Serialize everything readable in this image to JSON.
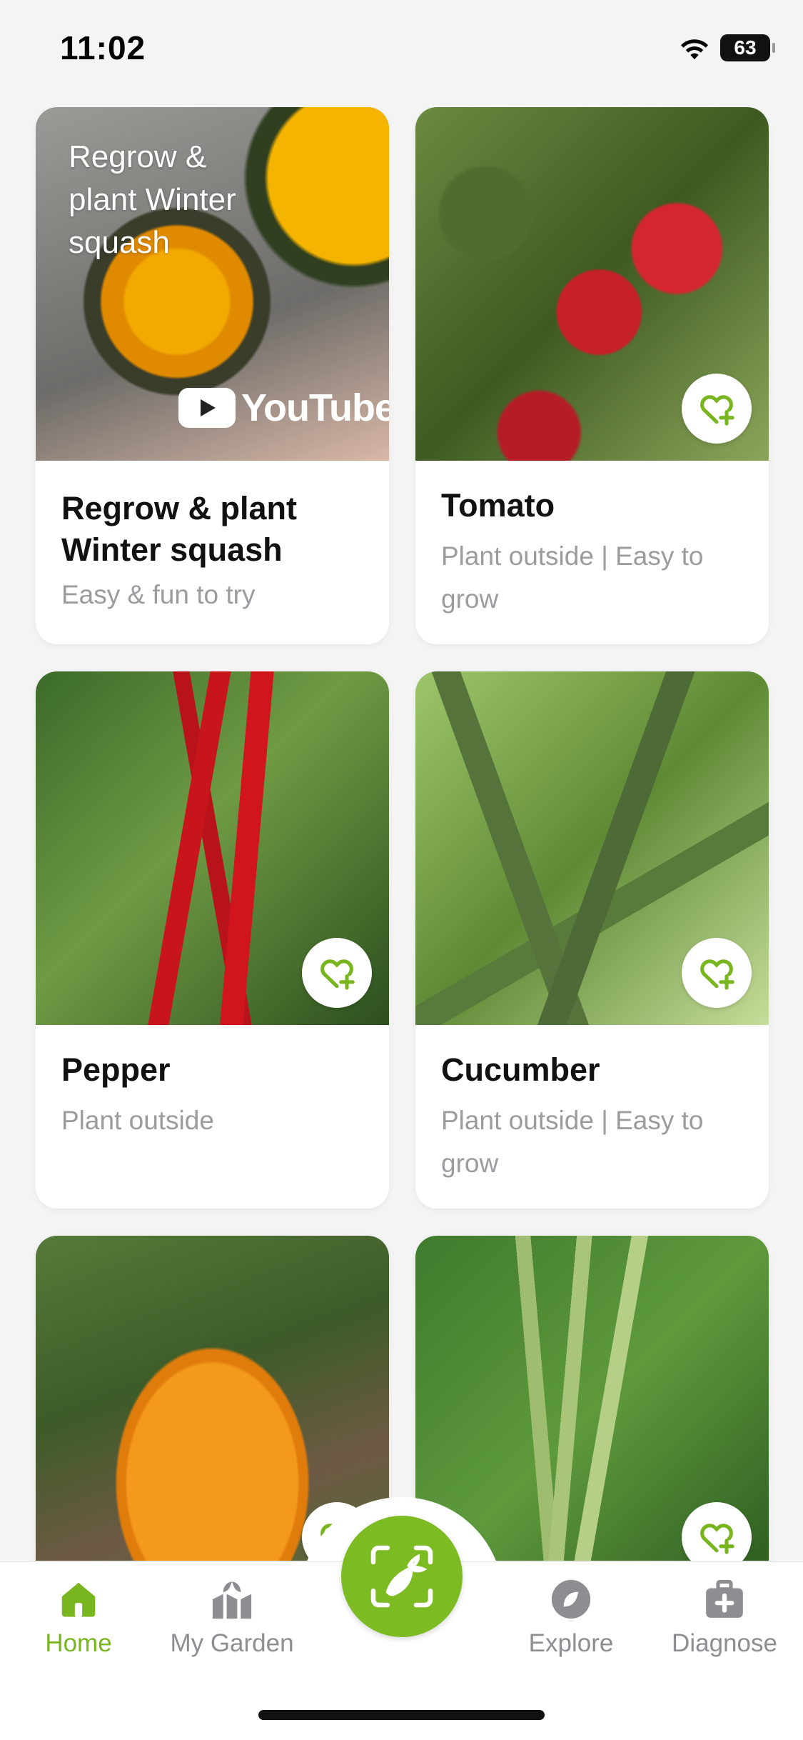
{
  "status_bar": {
    "time": "11:02",
    "battery": "63"
  },
  "cards": [
    {
      "kind": "video",
      "overlay_text": "Regrow & plant Winter squash",
      "video_brand": "YouTube",
      "title": "Regrow & plant Winter squash",
      "subtitle": "Easy & fun to try",
      "image": "winter-squash"
    },
    {
      "kind": "plant",
      "title": "Tomato",
      "subtitle": "Plant outside | Easy to grow",
      "image": "tomato"
    },
    {
      "kind": "plant",
      "title": "Pepper",
      "subtitle": "Plant outside",
      "image": "pepper"
    },
    {
      "kind": "plant",
      "title": "Cucumber",
      "subtitle": "Plant outside | Easy to grow",
      "image": "cucumber"
    },
    {
      "kind": "plant",
      "title": "",
      "subtitle": "",
      "image": "pumpkin"
    },
    {
      "kind": "plant",
      "title": "",
      "subtitle": "",
      "image": "green-beans"
    }
  ],
  "tab_bar": {
    "tabs": [
      {
        "label": "Home",
        "icon": "home-icon",
        "active": true
      },
      {
        "label": "My Garden",
        "icon": "garden-icon",
        "active": false
      },
      {
        "label": "Explore",
        "icon": "compass-icon",
        "active": false
      },
      {
        "label": "Diagnose",
        "icon": "first-aid-icon",
        "active": false
      }
    ],
    "center_action": "scan-plant-icon"
  },
  "colors": {
    "accent": "#7cbb22",
    "active_tab": "#78b51e",
    "inactive_tab": "#8d8d92",
    "background": "#f4f4f5"
  }
}
